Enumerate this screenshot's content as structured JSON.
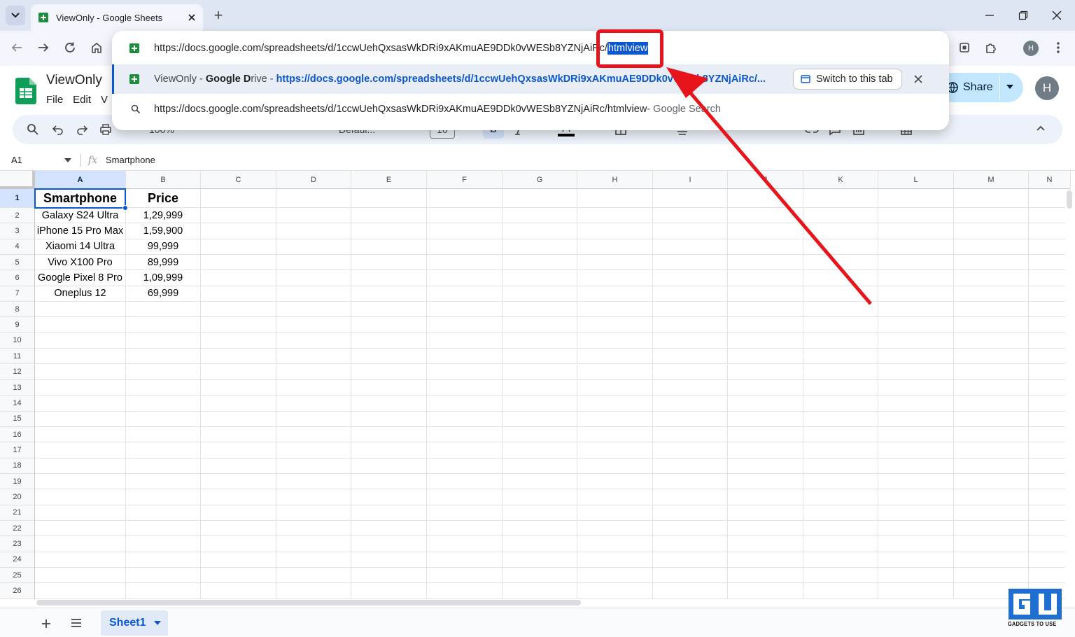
{
  "browser": {
    "tab_title": "ViewOnly - Google Sheets",
    "new_tab": "+",
    "avatar_letter": "H"
  },
  "omnibox": {
    "url_prefix": "https://docs.google.com/spreadsheets/d/1ccwUehQxsasWkDRi9xAKmuAE9DDk0vWESb8YZNjAiRc/",
    "url_selected": "htmlview",
    "suggestion1_prefix": "ViewOnly - ",
    "suggestion1_bold": "Google D",
    "suggestion1_rest": "rive - ",
    "suggestion1_url": "https://docs.google.com/spreadsheets/d/1ccwUehQxsasWkDRi9xAKmuAE9DDk0vWESb8YZNjAiRc/...",
    "switch_tab": "Switch to this tab",
    "suggestion2_text": "https://docs.google.com/spreadsheets/d/1ccwUehQxsasWkDRi9xAKmuAE9DDk0vWESb8YZNjAiRc/htmlview",
    "suggestion2_suffix": " - Google Search"
  },
  "doc": {
    "title": "ViewOnly",
    "menus": [
      "File",
      "Edit",
      "V"
    ],
    "share": "Share",
    "avatar_letter": "H",
    "zoom": "100%",
    "font": "Defaul...",
    "font_size": "10"
  },
  "formula_bar": {
    "cell_ref": "A1",
    "fx": "fx",
    "value": "Smartphone"
  },
  "sheet": {
    "columns": [
      "A",
      "B",
      "C",
      "D",
      "E",
      "F",
      "G",
      "H",
      "I",
      "J",
      "K",
      "L",
      "M",
      "N"
    ],
    "rows": [
      [
        "Smartphone",
        "Price"
      ],
      [
        "Galaxy S24 Ultra",
        "1,29,999"
      ],
      [
        "iPhone 15 Pro Max",
        "1,59,900"
      ],
      [
        "Xiaomi 14 Ultra",
        "99,999"
      ],
      [
        "Vivo X100 Pro",
        "89,999"
      ],
      [
        "Google Pixel 8 Pro",
        "1,09,999"
      ],
      [
        "Oneplus 12",
        "69,999"
      ]
    ],
    "row_count": 26,
    "tab_name": "Sheet1"
  },
  "watermark": "GADGETS TO USE",
  "colors": {
    "accent": "#0b57d0",
    "annotation": "#e8141c",
    "selection": "#0b57d0"
  }
}
